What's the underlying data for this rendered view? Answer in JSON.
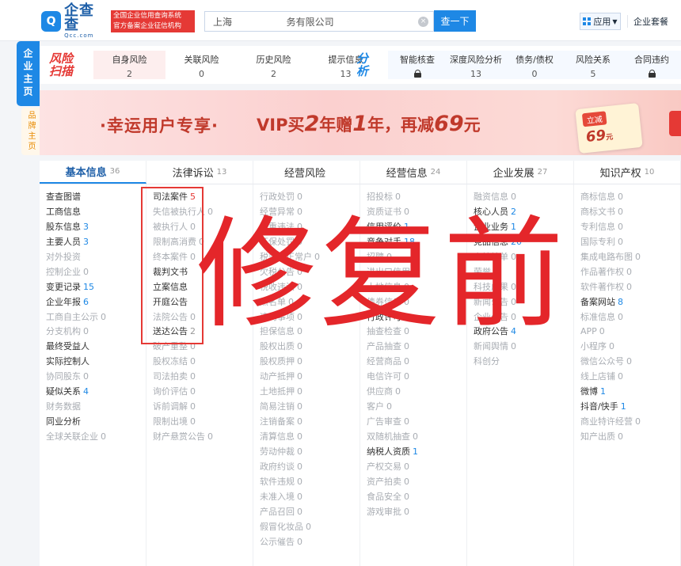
{
  "header": {
    "logo_cn": "企查查",
    "logo_en": "Qcc.com",
    "logo_mark": "Q",
    "slogan_line1": "全国企业信用查询系统",
    "slogan_line2": "官方备案企业征信机构",
    "search_value": "上海                  务有限公司",
    "search_button": "查一下",
    "apps_label": "应用",
    "suite_label": "企业套餐",
    "colors": {
      "brand": "#1e88e5",
      "slogan_bg": "#e53935"
    }
  },
  "side_tabs": {
    "main": "企业主页",
    "brand": "品牌主页"
  },
  "risk_scan": {
    "title": "风险扫描",
    "cells": [
      {
        "label": "自身风险",
        "value": "2",
        "active": true
      },
      {
        "label": "关联风险",
        "value": "0"
      },
      {
        "label": "历史风险",
        "value": "2"
      },
      {
        "label": "提示信息",
        "value": "13"
      }
    ]
  },
  "analysis": {
    "title": "分析",
    "cells": [
      {
        "label": "智能核查",
        "value": "",
        "locked": true
      },
      {
        "label": "深度风险分析",
        "value": "13"
      },
      {
        "label": "债务/债权",
        "value": "0"
      },
      {
        "label": "风险关系",
        "value": "5"
      },
      {
        "label": "合同违约",
        "value": "",
        "locked": true
      }
    ]
  },
  "banner": {
    "title": "·幸运用户专享·",
    "offer_prefix": "VIP买",
    "offer_buy": "2",
    "offer_mid": "年赠",
    "offer_gift": "1",
    "offer_suffix": "年，再减",
    "offer_discount": "69",
    "offer_unit": "元",
    "coupon_tag": "立减",
    "coupon_amount": "69",
    "coupon_unit": "元"
  },
  "categories": [
    {
      "label": "基本信息",
      "count": "36",
      "active": true
    },
    {
      "label": "法律诉讼",
      "count": "13"
    },
    {
      "label": "经营风险",
      "count": ""
    },
    {
      "label": "经营信息",
      "count": "24"
    },
    {
      "label": "企业发展",
      "count": "27"
    },
    {
      "label": "知识产权",
      "count": "10"
    }
  ],
  "columns": {
    "basic": [
      {
        "label": "查查图谱",
        "value": ""
      },
      {
        "label": "工商信息",
        "value": ""
      },
      {
        "label": "股东信息",
        "value": "3"
      },
      {
        "label": "主要人员",
        "value": "3"
      },
      {
        "label": "对外投资",
        "value": "",
        "dim": true
      },
      {
        "label": "控制企业",
        "value": "0",
        "dim": true
      },
      {
        "label": "变更记录",
        "value": "15"
      },
      {
        "label": "企业年报",
        "value": "6"
      },
      {
        "label": "工商自主公示",
        "value": "0",
        "dim": true
      },
      {
        "label": "分支机构",
        "value": "0",
        "dim": true
      },
      {
        "label": "最终受益人",
        "value": ""
      },
      {
        "label": "实际控制人",
        "value": ""
      },
      {
        "label": "协同股东",
        "value": "0",
        "dim": true
      },
      {
        "label": "疑似关系",
        "value": "4"
      },
      {
        "label": "财务数据",
        "value": "",
        "dim": true
      },
      {
        "label": "同业分析",
        "value": ""
      },
      {
        "label": "全球关联企业",
        "value": "0",
        "dim": true
      }
    ],
    "legal": [
      {
        "label": "司法案件",
        "value": "5",
        "red": true
      },
      {
        "label": "失信被执行人",
        "value": "0",
        "dim": true
      },
      {
        "label": "被执行人",
        "value": "0",
        "dim": true
      },
      {
        "label": "限制高消费",
        "value": "0",
        "dim": true
      },
      {
        "label": "终本案件",
        "value": "0",
        "dim": true
      },
      {
        "label": "裁判文书",
        "value": ""
      },
      {
        "label": "立案信息",
        "value": ""
      },
      {
        "label": "开庭公告",
        "value": ""
      },
      {
        "label": "法院公告",
        "value": "0",
        "dim": true
      },
      {
        "label": "送达公告",
        "value": "2",
        "grey": true
      },
      {
        "label": "破产重整",
        "value": "0",
        "dim": true
      },
      {
        "label": "股权冻结",
        "value": "0",
        "dim": true
      },
      {
        "label": "司法拍卖",
        "value": "0",
        "dim": true
      },
      {
        "label": "询价评估",
        "value": "0",
        "dim": true
      },
      {
        "label": "诉前调解",
        "value": "0",
        "dim": true
      },
      {
        "label": "限制出境",
        "value": "0",
        "dim": true
      },
      {
        "label": "财产悬赏公告",
        "value": "0",
        "dim": true
      }
    ],
    "risk": [
      {
        "label": "行政处罚",
        "value": "0",
        "dim": true
      },
      {
        "label": "经营异常",
        "value": "0",
        "dim": true
      },
      {
        "label": "严重违法",
        "value": "0",
        "dim": true
      },
      {
        "label": "环保处罚",
        "value": "0",
        "dim": true
      },
      {
        "label": "税务非正常户",
        "value": "0",
        "dim": true
      },
      {
        "label": "欠税公告",
        "value": "0",
        "dim": true
      },
      {
        "label": "税收违法",
        "value": "0",
        "dim": true
      },
      {
        "label": "黑名单",
        "value": "0",
        "dim": true
      },
      {
        "label": "违约事项",
        "value": "0",
        "dim": true
      },
      {
        "label": "担保信息",
        "value": "0",
        "dim": true
      },
      {
        "label": "股权出质",
        "value": "0",
        "dim": true
      },
      {
        "label": "股权质押",
        "value": "0",
        "dim": true
      },
      {
        "label": "动产抵押",
        "value": "0",
        "dim": true
      },
      {
        "label": "土地抵押",
        "value": "0",
        "dim": true
      },
      {
        "label": "简易注销",
        "value": "0",
        "dim": true
      },
      {
        "label": "注销备案",
        "value": "0",
        "dim": true
      },
      {
        "label": "清算信息",
        "value": "0",
        "dim": true
      },
      {
        "label": "劳动仲裁",
        "value": "0",
        "dim": true
      },
      {
        "label": "政府约谈",
        "value": "0",
        "dim": true
      },
      {
        "label": "软件违规",
        "value": "0",
        "dim": true
      },
      {
        "label": "未准入境",
        "value": "0",
        "dim": true
      },
      {
        "label": "产品召回",
        "value": "0",
        "dim": true
      },
      {
        "label": "假冒化妆品",
        "value": "0",
        "dim": true
      },
      {
        "label": "公示催告",
        "value": "0",
        "dim": true
      }
    ],
    "operation": [
      {
        "label": "招投标",
        "value": "0",
        "dim": true
      },
      {
        "label": "资质证书",
        "value": "0",
        "dim": true
      },
      {
        "label": "信用评价",
        "value": "1"
      },
      {
        "label": "竞争对手",
        "value": "18"
      },
      {
        "label": "招聘",
        "value": "0",
        "dim": true
      },
      {
        "label": "进出口信用",
        "value": "",
        "dim": true
      },
      {
        "label": "土地信息",
        "value": "0",
        "dim": true
      },
      {
        "label": "债券信息",
        "value": "0",
        "dim": true
      },
      {
        "label": "行政许可",
        "value": "4"
      },
      {
        "label": "抽查检查",
        "value": "0",
        "dim": true
      },
      {
        "label": "产品抽查",
        "value": "0",
        "dim": true
      },
      {
        "label": "经营商品",
        "value": "0",
        "dim": true
      },
      {
        "label": "电信许可",
        "value": "0",
        "dim": true
      },
      {
        "label": "供应商",
        "value": "0",
        "dim": true
      },
      {
        "label": "客户",
        "value": "0",
        "dim": true
      },
      {
        "label": "广告审查",
        "value": "0",
        "dim": true
      },
      {
        "label": "双随机抽查",
        "value": "0",
        "dim": true
      },
      {
        "label": "纳税人资质",
        "value": "1"
      },
      {
        "label": "产权交易",
        "value": "0",
        "dim": true
      },
      {
        "label": "资产拍卖",
        "value": "0",
        "dim": true
      },
      {
        "label": "食品安全",
        "value": "0",
        "dim": true
      },
      {
        "label": "游戏审批",
        "value": "0",
        "dim": true
      }
    ],
    "development": [
      {
        "label": "融资信息",
        "value": "0",
        "dim": true
      },
      {
        "label": "核心人员",
        "value": "2"
      },
      {
        "label": "企业业务",
        "value": "1"
      },
      {
        "label": "竞品信息",
        "value": "20"
      },
      {
        "label": "上榜榜单",
        "value": "0",
        "dim": true
      },
      {
        "label": "荣誉",
        "value": "0",
        "dim": true
      },
      {
        "label": "科技成果",
        "value": "0",
        "dim": true
      },
      {
        "label": "新闻公告",
        "value": "0",
        "dim": true
      },
      {
        "label": "企业公告",
        "value": "0",
        "dim": true
      },
      {
        "label": "政府公告",
        "value": "4"
      },
      {
        "label": "新闻舆情",
        "value": "0",
        "dim": true
      },
      {
        "label": "科创分",
        "value": "",
        "dim": true
      }
    ],
    "ip": [
      {
        "label": "商标信息",
        "value": "0",
        "dim": true
      },
      {
        "label": "商标文书",
        "value": "0",
        "dim": true
      },
      {
        "label": "专利信息",
        "value": "0",
        "dim": true
      },
      {
        "label": "国际专利",
        "value": "0",
        "dim": true
      },
      {
        "label": "集成电路布图",
        "value": "0",
        "dim": true
      },
      {
        "label": "作品著作权",
        "value": "0",
        "dim": true
      },
      {
        "label": "软件著作权",
        "value": "0",
        "dim": true
      },
      {
        "label": "备案网站",
        "value": "8"
      },
      {
        "label": "标准信息",
        "value": "0",
        "dim": true
      },
      {
        "label": "APP",
        "value": "0",
        "dim": true
      },
      {
        "label": "小程序",
        "value": "0",
        "dim": true
      },
      {
        "label": "微信公众号",
        "value": "0",
        "dim": true
      },
      {
        "label": "线上店铺",
        "value": "0",
        "dim": true
      },
      {
        "label": "微博",
        "value": "1"
      },
      {
        "label": "抖音/快手",
        "value": "1"
      },
      {
        "label": "商业特许经营",
        "value": "0",
        "dim": true
      },
      {
        "label": "知产出质",
        "value": "0",
        "dim": true
      }
    ]
  },
  "watermark": "修复前"
}
